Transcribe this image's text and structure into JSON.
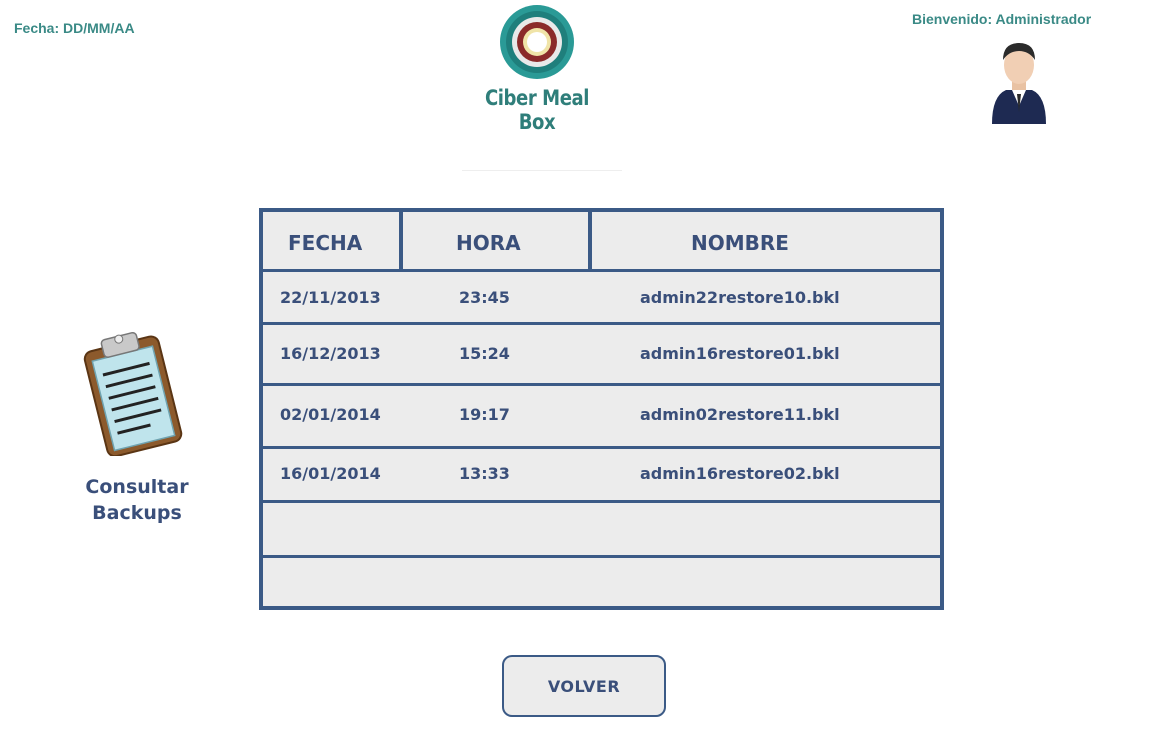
{
  "header": {
    "date_label": "Fecha: DD/MM/AA",
    "welcome_label": "Bienvenido: Administrador",
    "logo_text": "Ciber Meal Box"
  },
  "sidebar": {
    "section_line1": "Consultar",
    "section_line2": "Backups"
  },
  "table": {
    "columns": [
      "FECHA",
      "HORA",
      "NOMBRE"
    ],
    "rows": [
      {
        "fecha": "22/11/2013",
        "hora": "23:45",
        "nombre": "admin22restore10.bkl"
      },
      {
        "fecha": "16/12/2013",
        "hora": "15:24",
        "nombre": "admin16restore01.bkl"
      },
      {
        "fecha": "02/01/2014",
        "hora": "19:17",
        "nombre": "admin02restore11.bkl"
      },
      {
        "fecha": "16/01/2014",
        "hora": "13:33",
        "nombre": "admin16restore02.bkl"
      },
      {
        "fecha": "",
        "hora": "",
        "nombre": ""
      },
      {
        "fecha": "",
        "hora": "",
        "nombre": ""
      }
    ]
  },
  "buttons": {
    "back_label": "VOLVER"
  },
  "icons": {
    "logo": "logo-icon",
    "user": "user-avatar-icon",
    "section": "clipboard-icon"
  },
  "colors": {
    "teal": "#3a8a86",
    "navy": "#3b5a86",
    "text_blue": "#3a4f7a",
    "cell_bg": "#ececec"
  }
}
